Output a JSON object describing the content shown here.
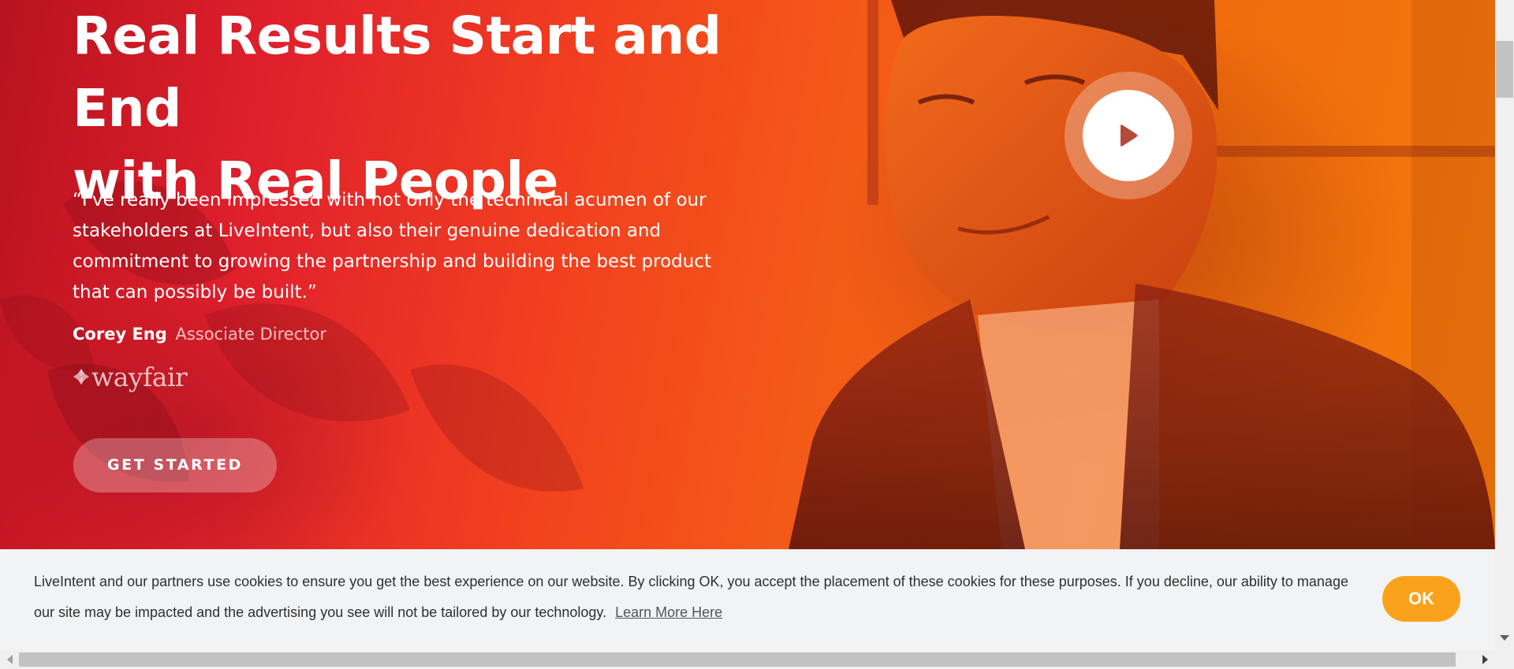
{
  "hero": {
    "heading_line1": "Real Results Start and End",
    "heading_line2": "with Real People",
    "quote": "“I've really been impressed with not only the technical acumen of our stakeholders at LiveIntent, but also their genuine dedication and commitment to growing the partnership and building the best product that can possibly be built.”",
    "attribution": {
      "name": "Corey Eng",
      "role": "Associate Director"
    },
    "brand_logo": "wayfair",
    "cta_label": "GET STARTED",
    "play_icon": "play-icon"
  },
  "cookie_banner": {
    "text": "LiveIntent and our partners use cookies to ensure you get the best experience on our website. By clicking OK, you accept the placement of these cookies for these purposes. If you decline, our ability to manage our site may be impacted and the advertising you see will not be tailored by our technology.",
    "link_label": "Learn More Here",
    "ok_label": "OK"
  },
  "colors": {
    "hero_gradient_start": "#b8121f",
    "hero_gradient_end": "#f27a0a",
    "ok_button": "#fba21c",
    "banner_bg": "#f2f3f5"
  }
}
